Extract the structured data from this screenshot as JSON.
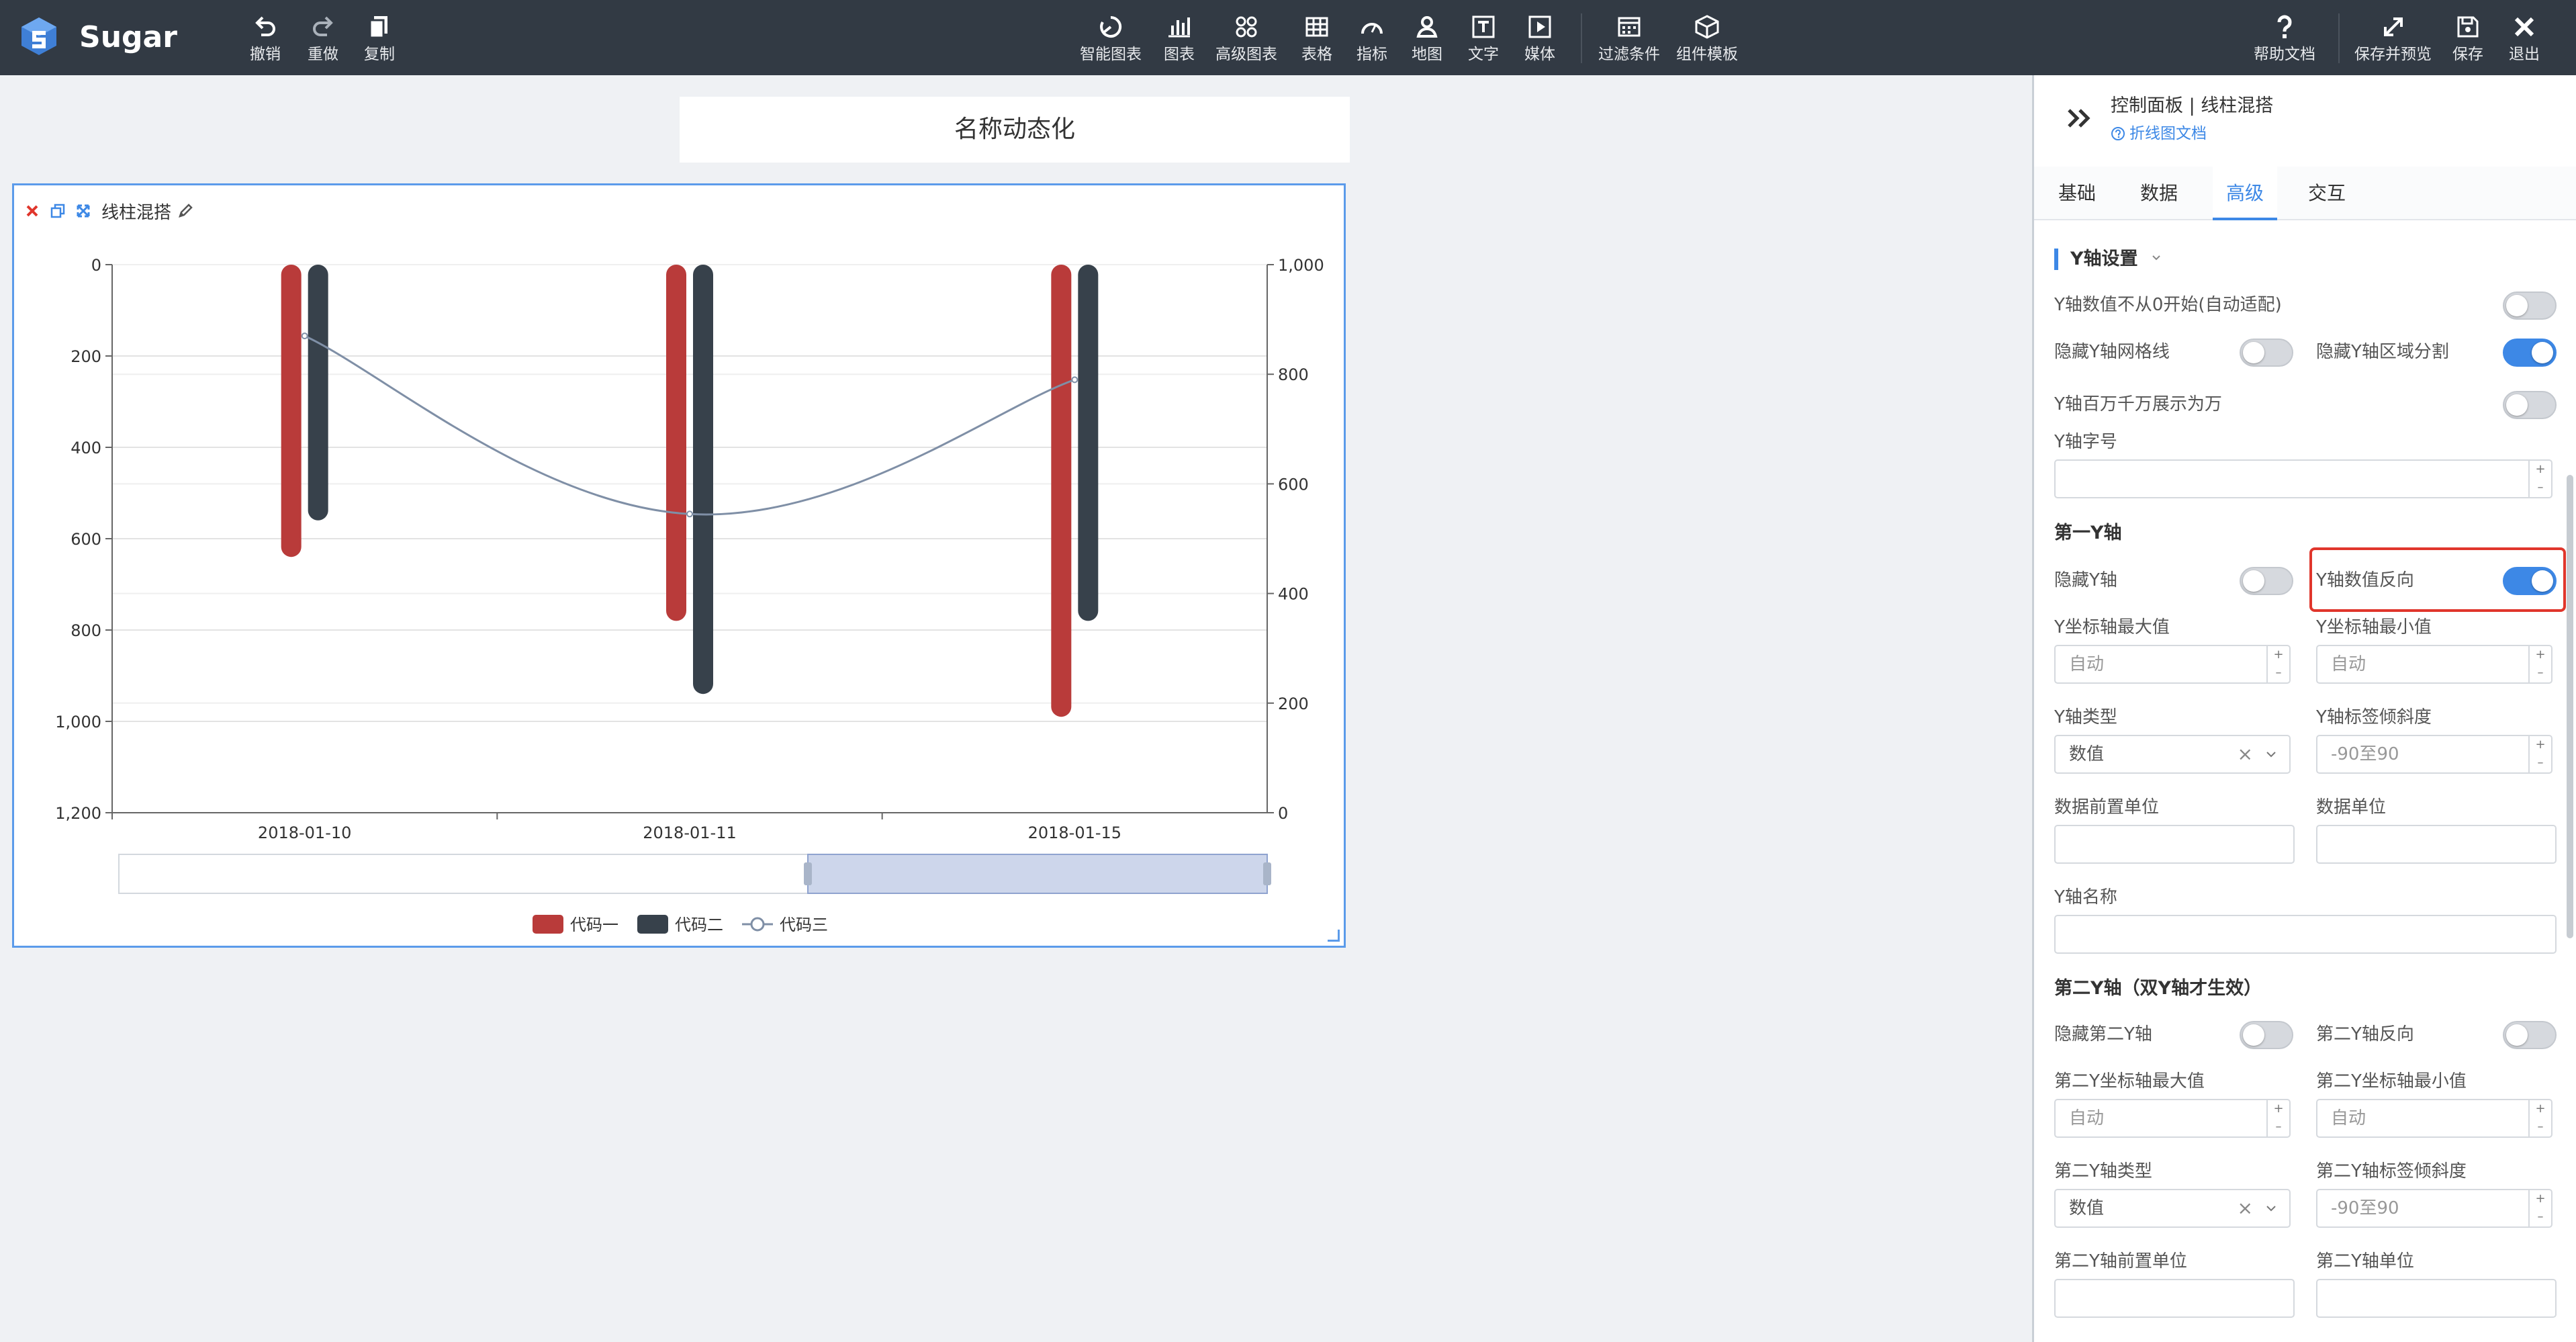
{
  "app": {
    "name": "Sugar"
  },
  "toolbar": {
    "left": [
      {
        "label": "撤销",
        "icon": "undo-icon"
      },
      {
        "label": "重做",
        "icon": "redo-icon"
      },
      {
        "label": "复制",
        "icon": "copy-icon"
      }
    ],
    "center": [
      {
        "label": "智能图表",
        "icon": "smart-chart-icon"
      },
      {
        "label": "图表",
        "icon": "bar-chart-icon"
      },
      {
        "label": "高级图表",
        "icon": "advanced-chart-icon"
      },
      {
        "label": "表格",
        "icon": "table-icon"
      },
      {
        "label": "指标",
        "icon": "gauge-icon"
      },
      {
        "label": "地图",
        "icon": "map-pin-icon"
      },
      {
        "label": "文字",
        "icon": "text-icon"
      },
      {
        "label": "媒体",
        "icon": "media-icon"
      },
      {
        "label": "过滤条件",
        "icon": "filter-icon"
      },
      {
        "label": "组件模板",
        "icon": "template-icon"
      }
    ],
    "right": [
      {
        "label": "帮助文档",
        "icon": "help-icon"
      },
      {
        "label": "保存并预览",
        "icon": "expand-icon"
      },
      {
        "label": "保存",
        "icon": "save-icon"
      },
      {
        "label": "退出",
        "icon": "close-icon"
      }
    ]
  },
  "canvas": {
    "title": "名称动态化"
  },
  "widget": {
    "name": "线柱混搭"
  },
  "chart_data": {
    "type": "bar",
    "categories": [
      "2018-01-10",
      "2018-01-11",
      "2018-01-15"
    ],
    "series": [
      {
        "name": "代码一",
        "type": "bar",
        "axis": "left",
        "color": "#b93b3a",
        "values": [
          640,
          780,
          990
        ]
      },
      {
        "name": "代码二",
        "type": "bar",
        "axis": "left",
        "color": "#37414b",
        "values": [
          560,
          940,
          780
        ]
      },
      {
        "name": "代码三",
        "type": "line",
        "axis": "right",
        "color": "#7f8fa6",
        "smooth": true,
        "values": [
          870,
          545,
          790
        ]
      }
    ],
    "y_left": {
      "min": 0,
      "max": 1200,
      "inverse": true,
      "ticks": [
        "0",
        "200",
        "400",
        "600",
        "800",
        "1,000",
        "1,200"
      ]
    },
    "y_right": {
      "min": 0,
      "max": 1000,
      "ticks": [
        "0",
        "200",
        "400",
        "600",
        "800",
        "1,000"
      ]
    },
    "grid": true,
    "legend": "bottom-center",
    "datazoom": {
      "start": 0.6,
      "end": 1.0
    }
  },
  "panel": {
    "title": "控制面板 | 线柱混搭",
    "doc_link": "折线图文档",
    "tabs": [
      "基础",
      "数据",
      "高级",
      "交互"
    ],
    "active_tab": "高级",
    "section_y": "Y轴设置",
    "y_not_zero": "Y轴数值不从0开始(自动适配)",
    "hide_y_grid": "隐藏Y轴网格线",
    "hide_y_split": "隐藏Y轴区域分割",
    "y_wan": "Y轴百万千万展示为万",
    "y_font": "Y轴字号",
    "first_y": "第一Y轴",
    "hide_y": "隐藏Y轴",
    "y_reverse": "Y轴数值反向",
    "y_max_label": "Y坐标轴最大值",
    "y_min_label": "Y坐标轴最小值",
    "y_max_ph": "自动",
    "y_min_ph": "自动",
    "y_type": "Y轴类型",
    "y_tilt": "Y轴标签倾斜度",
    "y_type_val": "数值",
    "y_tilt_ph": "-90至90",
    "prefix_unit": "数据前置单位",
    "data_unit": "数据单位",
    "y_name": "Y轴名称",
    "second_y": "第二Y轴（双Y轴才生效）",
    "hide_y2": "隐藏第二Y轴",
    "y2_reverse": "第二Y轴反向",
    "y2_max_label": "第二Y坐标轴最大值",
    "y2_min_label": "第二Y坐标轴最小值",
    "y2_max_ph": "自动",
    "y2_min_ph": "自动",
    "y2_type": "第二Y轴类型",
    "y2_tilt": "第二Y轴标签倾斜度",
    "y2_type_val": "数值",
    "y2_tilt_ph": "-90至90",
    "y2_prefix": "第二Y轴前置单位",
    "y2_unit": "第二Y轴单位",
    "toggles": {
      "y_not_zero": false,
      "hide_y_grid": false,
      "hide_y_split": true,
      "y_wan": false,
      "hide_y": false,
      "y_reverse": true,
      "hide_y2": false,
      "y2_reverse": false
    }
  }
}
